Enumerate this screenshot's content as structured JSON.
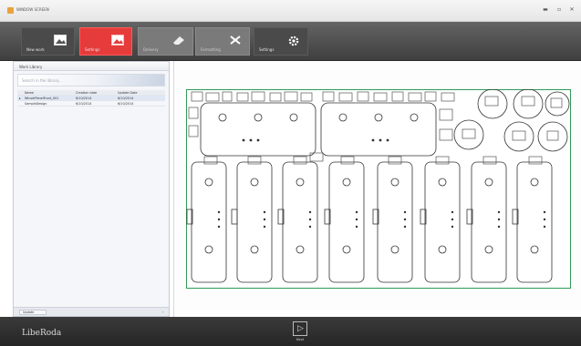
{
  "window": {
    "title": "WINDOW SCREEN",
    "icon": "app-icon",
    "controls": [
      "minimize-icon",
      "maximize-icon",
      "close-icon"
    ]
  },
  "toolbar": {
    "buttons": [
      {
        "label": "New work",
        "icon": "image-document-icon",
        "state": "normal"
      },
      {
        "label": "Settings",
        "icon": "image-document-icon",
        "state": "active"
      },
      {
        "label": "Delivery",
        "icon": "eraser-icon",
        "state": "disabled"
      },
      {
        "label": "Formatting",
        "icon": "scissors-icon",
        "state": "disabled"
      },
      {
        "label": "Settings",
        "icon": "gear-icon",
        "state": "normal"
      }
    ],
    "accent_color": "#e63b3b"
  },
  "library": {
    "title": "Work Library",
    "search_placeholder": "Search in the library...",
    "columns": [
      "Name",
      "Creation date",
      "Update Date"
    ],
    "rows": [
      {
        "marker": "▸",
        "name": "WinsetPanelFront_001",
        "created": "6/10/2014",
        "updated": "6/10/2014",
        "selected": true
      },
      {
        "marker": "",
        "name": "SampleDesign",
        "created": "6/10/2014",
        "updated": "6/10/2014",
        "selected": false
      }
    ],
    "update_label": "Update",
    "scroll_glyph": "›"
  },
  "footer": {
    "logo_text": "LibeRoda",
    "next_label": "Next",
    "next_glyph": "▷"
  }
}
